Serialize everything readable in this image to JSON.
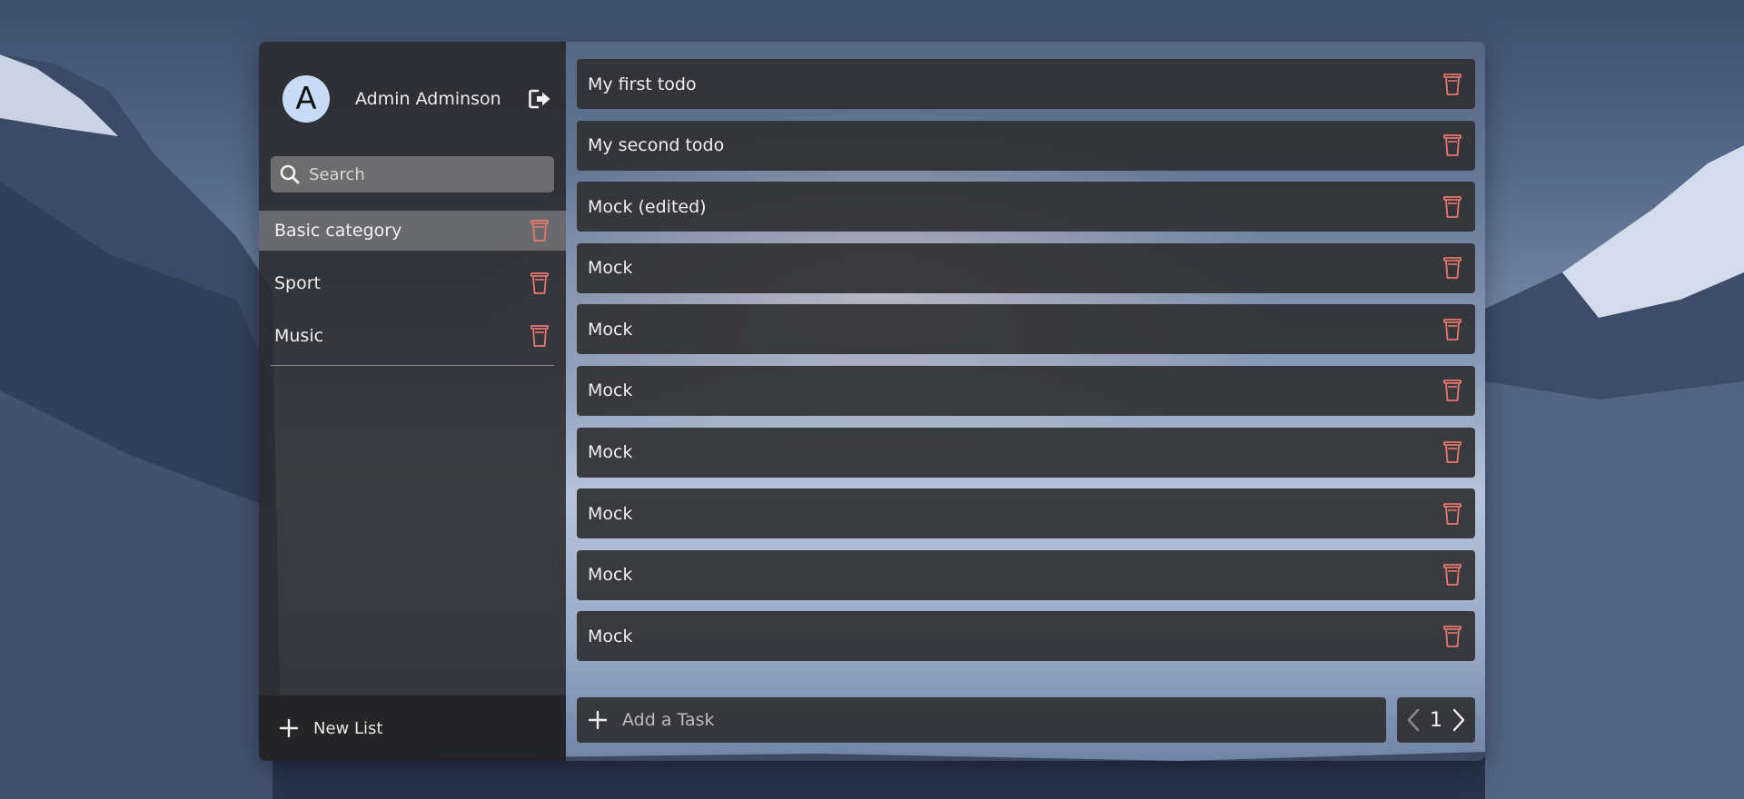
{
  "user": {
    "avatar_letter": "A",
    "name": "Admin Adminson"
  },
  "search": {
    "placeholder": "Search"
  },
  "categories": [
    {
      "label": "Basic category",
      "active": true
    },
    {
      "label": "Sport",
      "active": false
    },
    {
      "label": "Music",
      "active": false
    }
  ],
  "new_list_label": "New List",
  "todos": [
    {
      "label": "My first todo"
    },
    {
      "label": "My second todo"
    },
    {
      "label": "Mock (edited)"
    },
    {
      "label": "Mock"
    },
    {
      "label": "Mock"
    },
    {
      "label": "Mock"
    },
    {
      "label": "Mock"
    },
    {
      "label": "Mock"
    },
    {
      "label": "Mock"
    },
    {
      "label": "Mock"
    }
  ],
  "add_task": {
    "placeholder": "Add a Task"
  },
  "pagination": {
    "current_page": "1"
  },
  "colors": {
    "trash_icon": "#e8776f",
    "avatar_bg": "#c9dcf7"
  },
  "icons": {
    "logout": "logout-icon",
    "search": "search-icon",
    "trash": "trash-icon",
    "plus": "plus-icon",
    "prev": "chevron-left-icon",
    "next": "chevron-right-icon"
  }
}
